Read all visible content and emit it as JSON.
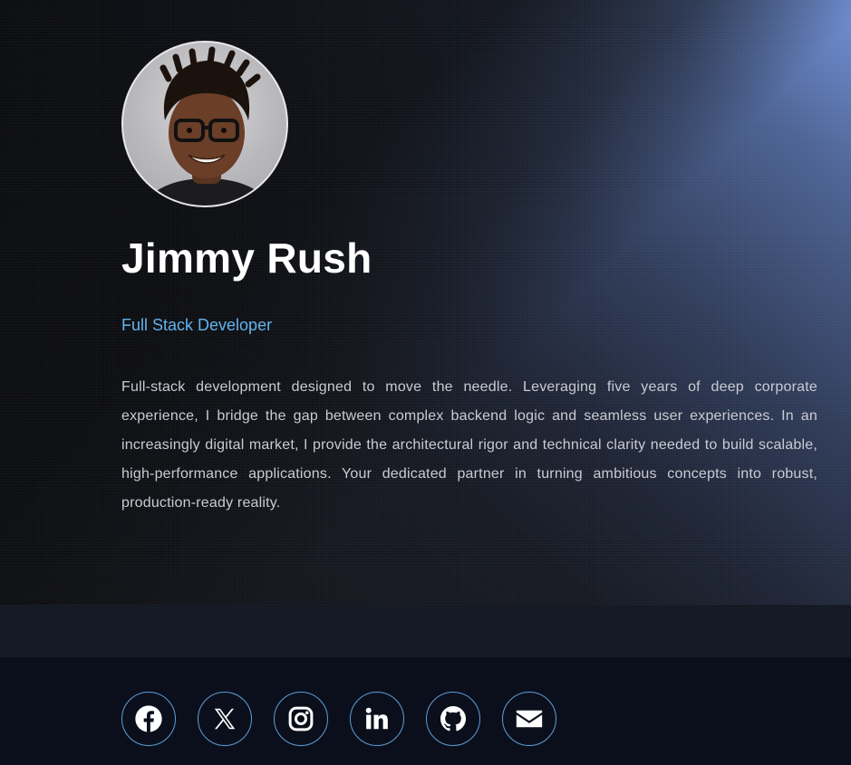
{
  "profile": {
    "name": "Jimmy Rush",
    "role": "Full Stack Developer",
    "bio": "Full-stack development designed to move the needle. Leveraging five years of deep corporate experience, I bridge the gap between complex backend logic and seamless user experiences. In an increasingly digital market, I provide the architectural rigor and technical clarity needed to build scalable, high-performance applications. Your dedicated partner in turning ambitious concepts into robust, production-ready reality."
  },
  "social": [
    {
      "icon": "facebook-icon"
    },
    {
      "icon": "x-twitter-icon"
    },
    {
      "icon": "instagram-icon"
    },
    {
      "icon": "linkedin-icon"
    },
    {
      "icon": "github-icon"
    },
    {
      "icon": "email-icon"
    }
  ],
  "colors": {
    "accent": "#63b3ed",
    "icon_border": "#5a9fd6",
    "footer_bg": "#0b0f1c",
    "band_bg": "#161a24"
  }
}
